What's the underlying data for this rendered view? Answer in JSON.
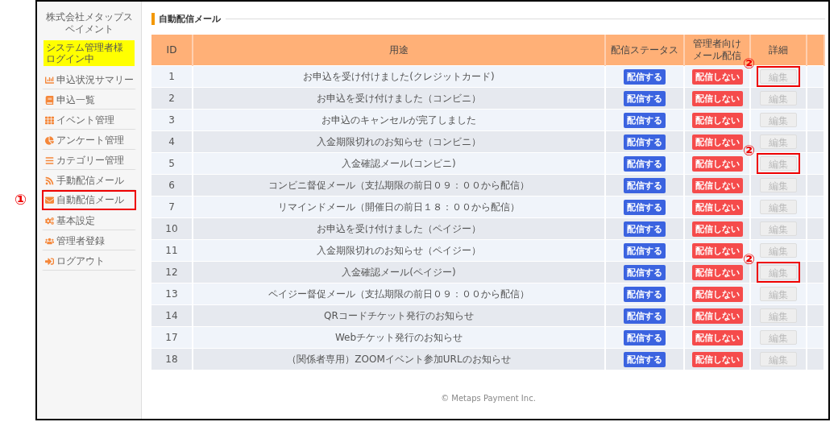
{
  "sidebar": {
    "company": "株式会社メタップスペイメント",
    "login_badge": [
      "システム管理者様",
      "ログイン中"
    ],
    "items": [
      {
        "label": "申込状況サマリー",
        "highlighted": false
      },
      {
        "label": "申込一覧",
        "highlighted": false
      },
      {
        "label": "イベント管理",
        "highlighted": false
      },
      {
        "label": "アンケート管理",
        "highlighted": false
      },
      {
        "label": "カテゴリー管理",
        "highlighted": false
      },
      {
        "label": "手動配信メール",
        "highlighted": false
      },
      {
        "label": "自動配信メール",
        "highlighted": true,
        "annotation": "①"
      },
      {
        "label": "基本設定",
        "highlighted": false
      },
      {
        "label": "管理者登録",
        "highlighted": false
      },
      {
        "label": "ログアウト",
        "highlighted": false
      }
    ]
  },
  "page_title": "自動配信メール",
  "table": {
    "columns": [
      "ID",
      "用途",
      "配信ステータス",
      "管理者向けメール配信",
      "詳細"
    ],
    "rows": [
      {
        "id": "1",
        "purpose": "お申込を受け付けました(クレジットカード)",
        "status": {
          "label": "配信する",
          "kind": "on"
        },
        "admin": {
          "label": "配信しない",
          "kind": "off"
        },
        "edit": {
          "label": "編集",
          "disabled": true,
          "highlighted": true,
          "annotation": "②"
        }
      },
      {
        "id": "2",
        "purpose": "お申込を受け付けました（コンビニ）",
        "status": {
          "label": "配信する",
          "kind": "on"
        },
        "admin": {
          "label": "配信しない",
          "kind": "off"
        },
        "edit": {
          "label": "編集",
          "disabled": true,
          "highlighted": false
        }
      },
      {
        "id": "3",
        "purpose": "お申込のキャンセルが完了しました",
        "status": {
          "label": "配信する",
          "kind": "on"
        },
        "admin": {
          "label": "配信しない",
          "kind": "off"
        },
        "edit": {
          "label": "編集",
          "disabled": true,
          "highlighted": false
        }
      },
      {
        "id": "4",
        "purpose": "入金期限切れのお知らせ（コンビニ）",
        "status": {
          "label": "配信する",
          "kind": "on"
        },
        "admin": {
          "label": "配信しない",
          "kind": "off"
        },
        "edit": {
          "label": "編集",
          "disabled": true,
          "highlighted": false
        }
      },
      {
        "id": "5",
        "purpose": "入金確認メール(コンビニ)",
        "status": {
          "label": "配信する",
          "kind": "on"
        },
        "admin": {
          "label": "配信しない",
          "kind": "off"
        },
        "edit": {
          "label": "編集",
          "disabled": true,
          "highlighted": true,
          "annotation": "②"
        }
      },
      {
        "id": "6",
        "purpose": "コンビニ督促メール（支払期限の前日０９：００から配信）",
        "status": {
          "label": "配信する",
          "kind": "on"
        },
        "admin": {
          "label": "配信しない",
          "kind": "off"
        },
        "edit": {
          "label": "編集",
          "disabled": true,
          "highlighted": false
        }
      },
      {
        "id": "7",
        "purpose": "リマインドメール（開催日の前日１８：００から配信）",
        "status": {
          "label": "配信する",
          "kind": "on"
        },
        "admin": {
          "label": "配信しない",
          "kind": "off"
        },
        "edit": {
          "label": "編集",
          "disabled": true,
          "highlighted": false
        }
      },
      {
        "id": "10",
        "purpose": "お申込を受け付けました（ペイジー）",
        "status": {
          "label": "配信する",
          "kind": "on"
        },
        "admin": {
          "label": "配信しない",
          "kind": "off"
        },
        "edit": {
          "label": "編集",
          "disabled": true,
          "highlighted": false
        }
      },
      {
        "id": "11",
        "purpose": "入金期限切れのお知らせ（ペイジー）",
        "status": {
          "label": "配信する",
          "kind": "on"
        },
        "admin": {
          "label": "配信しない",
          "kind": "off"
        },
        "edit": {
          "label": "編集",
          "disabled": true,
          "highlighted": false
        }
      },
      {
        "id": "12",
        "purpose": "入金確認メール(ペイジー)",
        "status": {
          "label": "配信する",
          "kind": "on"
        },
        "admin": {
          "label": "配信しない",
          "kind": "off"
        },
        "edit": {
          "label": "編集",
          "disabled": true,
          "highlighted": true,
          "annotation": "②"
        }
      },
      {
        "id": "13",
        "purpose": "ペイジー督促メール（支払期限の前日０９：００から配信）",
        "status": {
          "label": "配信する",
          "kind": "on"
        },
        "admin": {
          "label": "配信しない",
          "kind": "off"
        },
        "edit": {
          "label": "編集",
          "disabled": true,
          "highlighted": false
        }
      },
      {
        "id": "14",
        "purpose": "QRコードチケット発行のお知らせ",
        "status": {
          "label": "配信する",
          "kind": "on"
        },
        "admin": {
          "label": "配信しない",
          "kind": "off"
        },
        "edit": {
          "label": "編集",
          "disabled": true,
          "highlighted": false
        }
      },
      {
        "id": "17",
        "purpose": "Webチケット発行のお知らせ",
        "status": {
          "label": "配信する",
          "kind": "on"
        },
        "admin": {
          "label": "配信しない",
          "kind": "off"
        },
        "edit": {
          "label": "編集",
          "disabled": true,
          "highlighted": false
        }
      },
      {
        "id": "18",
        "purpose": "（関係者専用）ZOOMイベント参加URLのお知らせ",
        "status": {
          "label": "配信する",
          "kind": "on"
        },
        "admin": {
          "label": "配信しない",
          "kind": "off"
        },
        "edit": {
          "label": "編集",
          "disabled": true,
          "highlighted": false
        }
      }
    ]
  },
  "footer": "© Metaps Payment Inc."
}
